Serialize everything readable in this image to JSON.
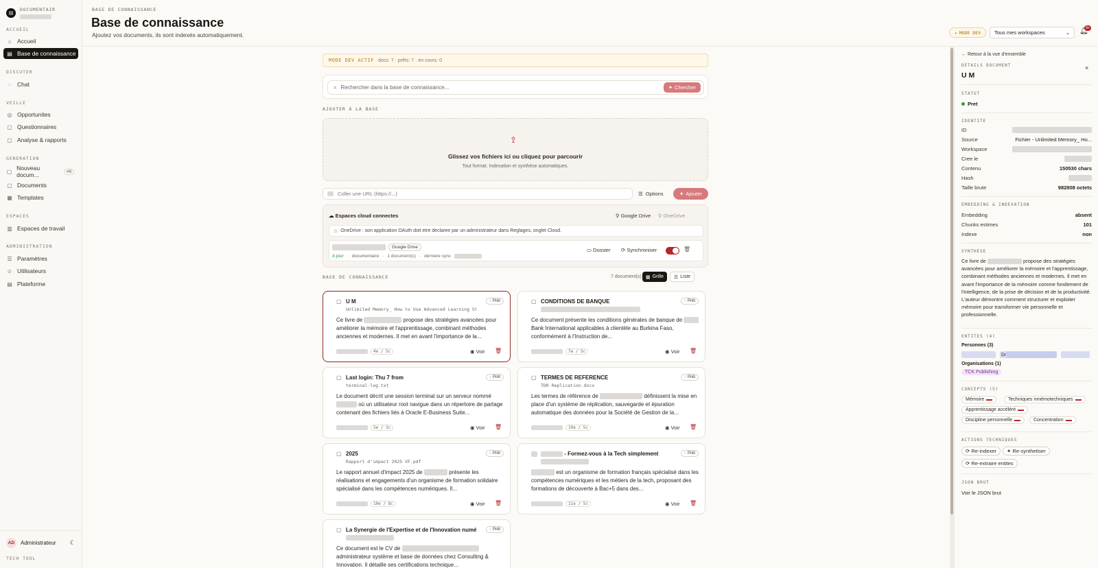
{
  "app": {
    "brand": "DOCUMENTAIR",
    "brand_logo_glyph": "▤"
  },
  "sidebar": {
    "sections": [
      {
        "title": "ACCUEIL",
        "items": [
          {
            "label": "Accueil",
            "icon": "home-icon",
            "glyph": "⌂"
          },
          {
            "label": "Base de connaissance",
            "icon": "database-icon",
            "glyph": "▤",
            "active": true
          }
        ]
      },
      {
        "title": "DISCUTER",
        "items": [
          {
            "label": "Chat",
            "icon": "chat-icon",
            "glyph": "◌"
          }
        ]
      },
      {
        "title": "VEILLE",
        "items": [
          {
            "label": "Opportunites",
            "icon": "target-icon",
            "glyph": "◎"
          },
          {
            "label": "Questionnaires",
            "icon": "file-icon",
            "glyph": "▢"
          },
          {
            "label": "Analyse & rapports",
            "icon": "file-chart-icon",
            "glyph": "▢"
          }
        ]
      },
      {
        "title": "GENERATION",
        "items": [
          {
            "label": "Nouveau docum...",
            "icon": "file-plus-icon",
            "glyph": "▢",
            "kbd": "⌘N"
          },
          {
            "label": "Documents",
            "icon": "file-icon",
            "glyph": "▢"
          },
          {
            "label": "Templates",
            "icon": "grid-icon",
            "glyph": "▦"
          }
        ]
      },
      {
        "title": "ESPACES",
        "items": [
          {
            "label": "Espaces de travail",
            "icon": "building-icon",
            "glyph": "▥"
          }
        ]
      },
      {
        "title": "ADMINISTRATION",
        "items": [
          {
            "label": "Paramètres",
            "icon": "sliders-icon",
            "glyph": "☰"
          },
          {
            "label": "Utilisateurs",
            "icon": "users-icon",
            "glyph": "☺"
          },
          {
            "label": "Plateforme",
            "icon": "server-icon",
            "glyph": "▤"
          }
        ]
      }
    ],
    "user": {
      "initials": "AD",
      "name": "Administrateur",
      "theme_icon": "☾"
    },
    "footer": "TECH TOOL"
  },
  "header": {
    "breadcrumb": "BASE DE CONNAISSANCE",
    "title": "Base de connaissance",
    "subtitle": "Ajoutez vos documents, ils sont indexés automatiquement.",
    "dev_badge": "MODE DEV",
    "workspace_select": "Tous mes workspaces",
    "notif_count": "9+"
  },
  "main": {
    "devbar": {
      "title": "MODE DEV ACTIF",
      "info": "docs: 7 · prêts: 7 · en cours: 0"
    },
    "search": {
      "placeholder": "Rechercher dans la base de connaissance...",
      "button": "Chercher"
    },
    "add_label": "AJOUTER À LA BASE",
    "drop": {
      "title": "Glissez vos fichiers ici ou cliquez pour parcourir",
      "subtitle": "Tout format. Indexation et synthèse automatiques."
    },
    "url": {
      "placeholder": "Coller une URL (https://...)",
      "options": "Options",
      "add": "Ajouter"
    },
    "cloud": {
      "title": "Espaces cloud connectes",
      "google": "Google Drive",
      "onedrive": "OneDrive",
      "warning": "OneDrive : son application OAuth doit etre declaree par un administrateur dans Reglages, onglet Cloud.",
      "conn_tag": "Google Drive",
      "conn_status": "A jour",
      "conn_type": "documentaire",
      "conn_count": "1 document(s)",
      "conn_sync": "derniere sync",
      "folder": "Dossier",
      "sync": "Synchroniser"
    },
    "kb": {
      "label": "BASE DE CONNAISSANCE",
      "count": "7 document(s)",
      "grid": "Grille",
      "list": "Liste"
    },
    "voir": "Voir",
    "ready": "Prêt",
    "cards": [
      {
        "title": "U M",
        "filename": "Unlimited Memory_ How to Use Advanced Learning St...",
        "desc_a": "Ce livre de",
        "desc_b": "propose des stratégies avancées pour améliorer la mémoire et l'apprentissage, combinant méthodes anciennes et modernes. Il met en avant l'importance de la...",
        "meta": "4e / 5c"
      },
      {
        "title": "CONDITIONS DE BANQUE",
        "filename": "",
        "desc_a": "Ce document présente les conditions générales de banque de",
        "desc_b": "Bank International   applicables à   clientèle au Burkina Faso, conformément à l'Instruction   de...",
        "meta": "7e / 5c"
      },
      {
        "title": "Last login: Thu     7               from",
        "filename": "terminal-log.txt",
        "desc_a": "Le document décrit une session terminal sur un serveur nommé",
        "desc_b": "où un utilisateur root navigue dans un répertoire de partage contenant des fichiers liés à Oracle E-Business Suite...",
        "meta": "5e / 3c"
      },
      {
        "title": "TERMES DE REFERENCE",
        "filename": "TDR Replication.docx",
        "desc_a": "Les termes de référence de",
        "desc_b": "définissent la mise en place d'un système de réplication, sauvegarde et épuration automatique des données pour la Société de Gestion de la...",
        "meta": "10e / 5c"
      },
      {
        "title": "2025",
        "filename": "Rapport d'impact        2025 VF.pdf",
        "desc_a": "Le rapport annuel d'impact 2025 de",
        "desc_b": "présente les réalisations et engagements d'un organisme de formation solidaire spécialisé dans les compétences numériques. Il...",
        "meta": "10e / 8c"
      },
      {
        "title": "- Formez-vous à la Tech simplement",
        "filename": "",
        "desc_a": "",
        "desc_b": "est un organisme de formation français spécialisé dans les compétences numériques et les métiers de la tech, proposant des formations de découverte à Bac+5 dans des...",
        "meta": "11e / 5c"
      },
      {
        "title": "La Synergie de l'Expertise et de l'Innovation numérique",
        "filename": "",
        "desc_a": "Ce document est le CV de",
        "desc_b": "administrateur système et base de données chez          Consulting & Innovation. Il détaille ses certifications technique...",
        "meta": ""
      }
    ]
  },
  "panel": {
    "back": "Retour à la vue d'ensemble",
    "details_label": "DETAILS DOCUMENT",
    "doc_title": "U M",
    "statut_label": "STATUT",
    "statut": "Pret",
    "identite_label": "IDENTITE",
    "identity": [
      {
        "k": "ID",
        "v": ""
      },
      {
        "k": "Source",
        "v": "Fichier - Unlimited Memory_ Ho..."
      },
      {
        "k": "Workspace",
        "v": ""
      },
      {
        "k": "Cree le",
        "v": ""
      },
      {
        "k": "Contenu",
        "v": "150530 chars"
      },
      {
        "k": "Hash",
        "v": ""
      },
      {
        "k": "Taille brute",
        "v": "982808 octets"
      }
    ],
    "embed_label": "EMBEDDING & INDEXATION",
    "embedding": [
      {
        "k": "Embedding",
        "v": "absent"
      },
      {
        "k": "Chunks estimes",
        "v": "101"
      },
      {
        "k": "Indexe",
        "v": "non"
      }
    ],
    "synthese_label": "SYNTHESE",
    "synthese_a": "Ce livre de",
    "synthese_b": "propose des stratégies avancées pour améliorer la mémoire et l'apprentissage, combinant méthodes anciennes et modernes. Il met en avant l'importance de la mémoire comme fondement de l'intelligence, de la prise de décision et de la productivité. L'auteur démontre comment structurer et exploiter   mémoire pour transformer   vie personnelle et professionnelle.",
    "entites_label": "ENTITES (4)",
    "personnes_label": "Personnes (3)",
    "person_prefix": "Dr",
    "orgs_label": "Organisations (1)",
    "org": "TCK Publishing",
    "concepts_label": "CONCEPTS (5)",
    "concepts": [
      "Mémoire",
      "Techniques mnémotechniques",
      "Apprentissage accéléré",
      "Discipline personnelle",
      "Concentration"
    ],
    "actions_label": "ACTIONS TECHNIQUES",
    "actions": [
      "Re-indexer",
      "Re-synthetiser",
      "Re-extraire entites"
    ],
    "json_label": "JSON BRUT",
    "json_link": "Voir le JSON brut"
  }
}
